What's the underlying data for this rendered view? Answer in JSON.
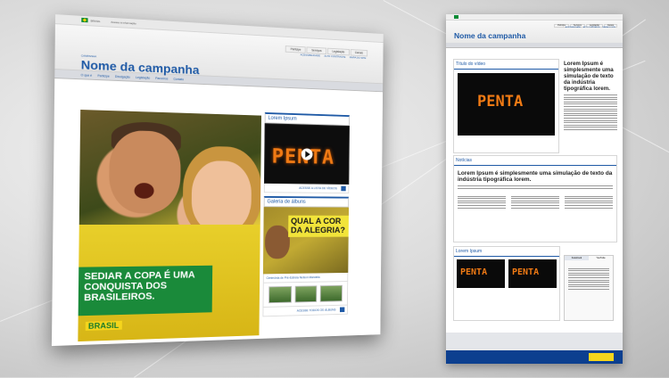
{
  "left_site": {
    "top_bar": {
      "flag_text": "BRASIL",
      "info_text": "Acesso à informação"
    },
    "top_tabs": [
      "Participe",
      "Serviços",
      "Legislação",
      "Canais"
    ],
    "accessibility": [
      "ACESSIBILIDADE",
      "ALTO CONTRASTE",
      "MAPA DO SITE"
    ],
    "campaign_label": "CAMPANHA",
    "campaign_title": "Nome da campanha",
    "nav": [
      "O que é",
      "Participe",
      "Divulgação",
      "Legislação",
      "Parceiros",
      "Contato"
    ],
    "hero_banner": "SEDIAR A COPA É UMA CONQUISTA DOS BRASILEIROS.",
    "hero_logo": "BRASIL",
    "video_box": {
      "title": "Lorem Ipsum",
      "video_word": "PENTA",
      "more_link": "ACESSE A LISTA DE VÍDEOS"
    },
    "gallery_box": {
      "title": "Galeria de álbuns",
      "album_text": "QUAL A COR DA ALEGRIA?",
      "caption": "Cerimônia de Pré-Estreia Nelson Mandela",
      "more_link": "ACESSE TODOS OS ÁLBUNS"
    }
  },
  "right_site": {
    "campaign_label": "CAMPANHA",
    "campaign_title": "Nome da campanha",
    "video_panel_title": "Título do vídeo",
    "video_word": "PENTA",
    "side_heading": "Lorem Ipsum é simplesmente uma simulação de texto da indústria tipográfica lorem.",
    "news_panel_title": "Notícias",
    "news_heading": "Lorem Ipsum é simplesmente uma simulação de texto da indústria tipográfica lorem.",
    "lorem_panel_title": "Lorem Ipsum",
    "twitter_tabs": [
      "Facebook",
      "YouTube"
    ]
  }
}
